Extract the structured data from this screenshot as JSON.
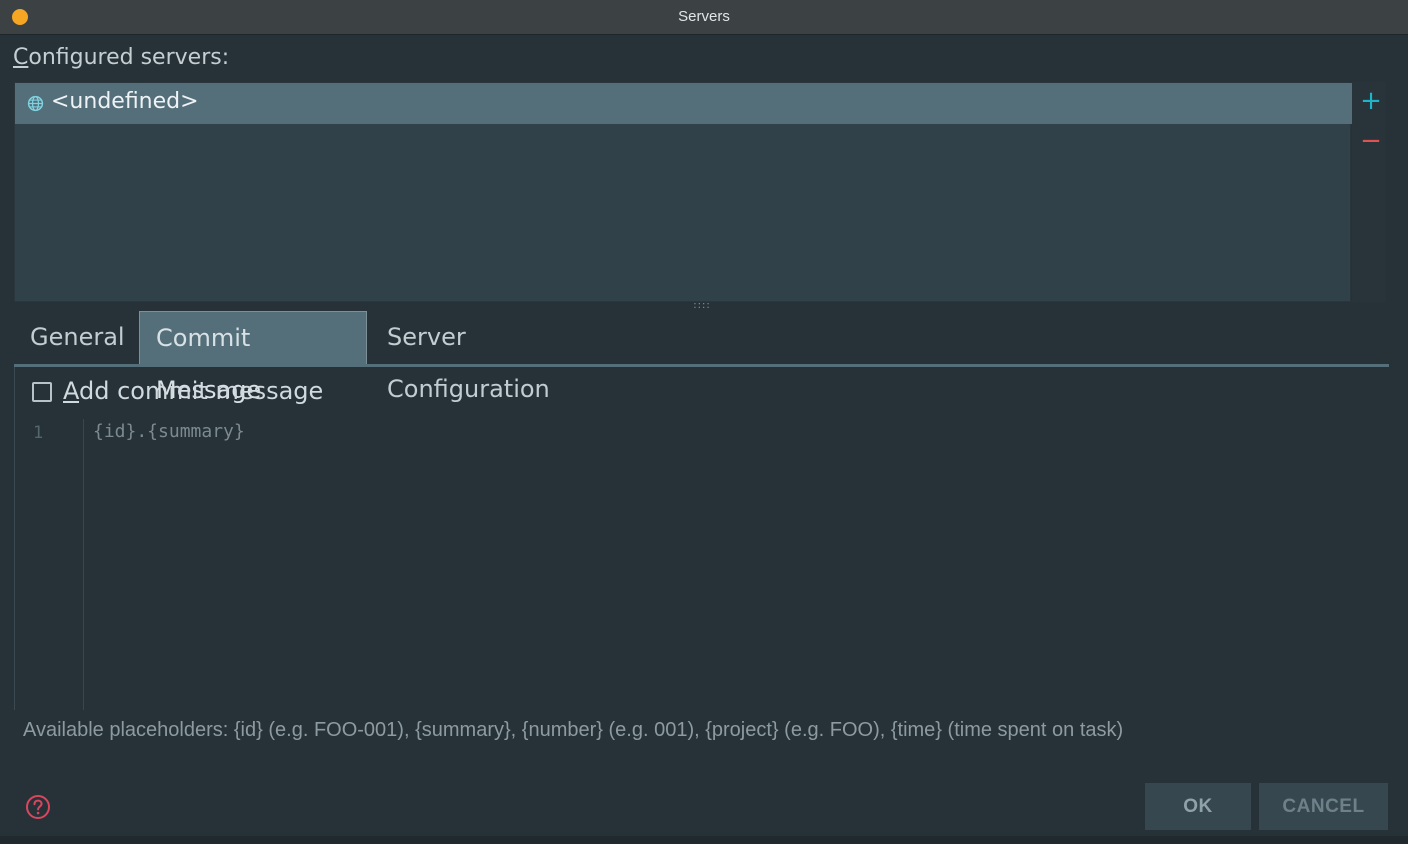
{
  "window": {
    "title": "Servers"
  },
  "servers": {
    "label_prefix": "C",
    "label_rest": "onfigured servers:",
    "items": [
      {
        "name": "<undefined>",
        "icon": "globe-icon"
      }
    ],
    "add_icon": "+",
    "remove_icon": "−"
  },
  "splitter": {
    "glyph": "::::"
  },
  "tabs": [
    {
      "label": "General"
    },
    {
      "label": "Commit Message",
      "selected": true
    },
    {
      "label": "Server Configuration"
    }
  ],
  "commit": {
    "checkbox_prefix": "A",
    "checkbox_rest": "dd commit message",
    "checked": false,
    "line_number": "1",
    "template": "{id}.{summary}"
  },
  "placeholders": "Available placeholders: {id} (e.g. FOO-001), {summary}, {number} (e.g. 001), {project} (e.g. FOO), {time} (time spent on task)",
  "footer": {
    "ok_label": "OK",
    "cancel_label": "CANCEL",
    "help_icon": "help-icon"
  },
  "colors": {
    "accent": "#1fb5c9",
    "remove": "#e05252",
    "selection": "#546e7a",
    "dot": "#f5a623"
  }
}
